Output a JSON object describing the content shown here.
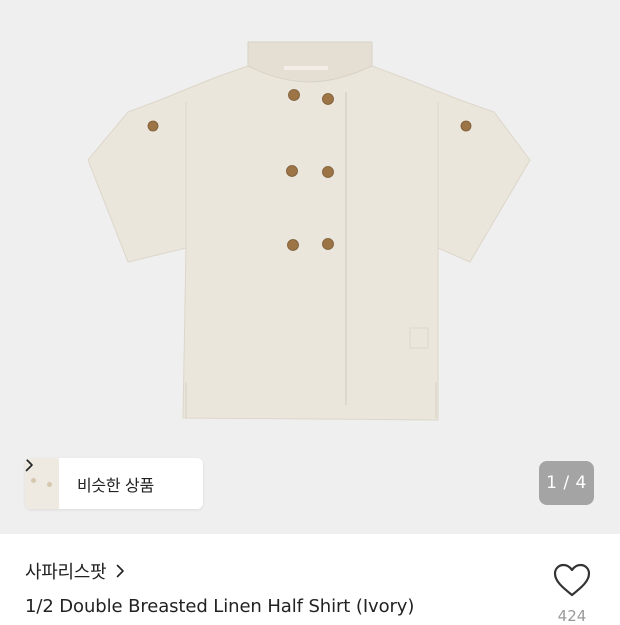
{
  "product": {
    "image_alt": "Ivory linen double breasted half shirt",
    "shirt_color": "#ebe6dc",
    "button_color": "#9c7446"
  },
  "similar": {
    "label": "비슷한 상품"
  },
  "gallery": {
    "counter": "1 / 4"
  },
  "brand": {
    "name": "사파리스팟"
  },
  "title": "1/2 Double Breasted Linen Half Shirt (Ivory)",
  "likes": {
    "count": "424"
  }
}
